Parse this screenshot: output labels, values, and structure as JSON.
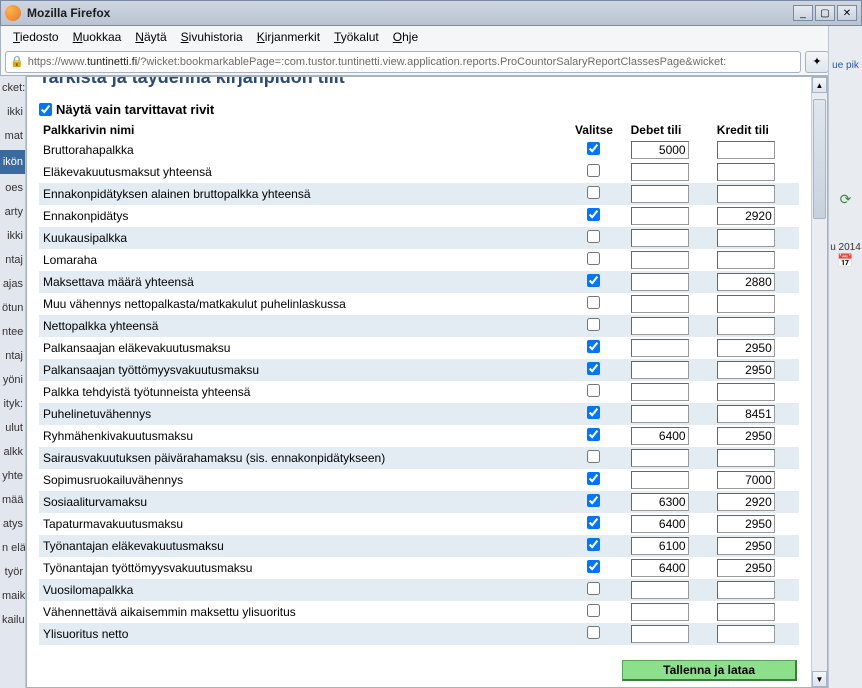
{
  "window": {
    "title": "Mozilla Firefox",
    "url_prefix": "https://www.",
    "url_domain": "tuntinetti.fi",
    "url_rest": "/?wicket:bookmarkablePage=:com.tustor.tuntinetti.view.application.reports.ProCountorSalaryReportClassesPage&wicket:"
  },
  "menubar": {
    "items": [
      "Tiedosto",
      "Muokkaa",
      "Näytä",
      "Sivuhistoria",
      "Kirjanmerkit",
      "Työkalut",
      "Ohje"
    ]
  },
  "right_strip": {
    "link_fragment": "ue pik",
    "date_fragment": "u 2014"
  },
  "left_strip": {
    "frags": [
      "cket:",
      "ikki",
      "mat",
      "ikön",
      "oes",
      "arty",
      "ikki",
      "ntaj",
      "ajas",
      "ötun",
      "ntee",
      "ntaj",
      "yöni",
      "ityk:",
      "ulut",
      "alkk",
      "yhte",
      "mää",
      "atys",
      "n elä",
      "työr",
      "maik",
      "kailu"
    ]
  },
  "page": {
    "cut_title": "Tarkista ja täydennä kirjanpidon tilit",
    "filter_checkbox_label": "Näytä vain tarvittavat rivit",
    "filter_checked": true,
    "headers": {
      "name": "Palkkarivin nimi",
      "select": "Valitse",
      "debit": "Debet tili",
      "credit": "Kredit tili"
    },
    "save_button": "Tallenna ja lataa",
    "rows": [
      {
        "name": "Bruttorahapalkka",
        "checked": true,
        "debit": "5000",
        "credit": "",
        "zebra": false
      },
      {
        "name": "Eläkevakuutusmaksut yhteensä",
        "checked": false,
        "debit": "",
        "credit": "",
        "zebra": false
      },
      {
        "name": "Ennakonpidätyksen alainen bruttopalkka yhteensä",
        "checked": false,
        "debit": "",
        "credit": "",
        "zebra": true
      },
      {
        "name": "Ennakonpidätys",
        "checked": true,
        "debit": "",
        "credit": "2920",
        "zebra": false
      },
      {
        "name": "Kuukausipalkka",
        "checked": false,
        "debit": "",
        "credit": "",
        "zebra": true
      },
      {
        "name": "Lomaraha",
        "checked": false,
        "debit": "",
        "credit": "",
        "zebra": false
      },
      {
        "name": "Maksettava määrä yhteensä",
        "checked": true,
        "debit": "",
        "credit": "2880",
        "zebra": true
      },
      {
        "name": "Muu vähennys nettopalkasta/matkakulut puhelinlaskussa",
        "checked": false,
        "debit": "",
        "credit": "",
        "zebra": false
      },
      {
        "name": "Nettopalkka yhteensä",
        "checked": false,
        "debit": "",
        "credit": "",
        "zebra": true
      },
      {
        "name": "Palkansaajan eläkevakuutusmaksu",
        "checked": true,
        "debit": "",
        "credit": "2950",
        "zebra": false
      },
      {
        "name": "Palkansaajan työttömyysvakuutusmaksu",
        "checked": true,
        "debit": "",
        "credit": "2950",
        "zebra": true
      },
      {
        "name": "Palkka tehdyistä työtunneista yhteensä",
        "checked": false,
        "debit": "",
        "credit": "",
        "zebra": false
      },
      {
        "name": "Puhelinetuvähennys",
        "checked": true,
        "debit": "",
        "credit": "8451",
        "zebra": true
      },
      {
        "name": "Ryhmähenkivakuutusmaksu",
        "checked": true,
        "debit": "6400",
        "credit": "2950",
        "zebra": false
      },
      {
        "name": "Sairausvakuutuksen päivärahamaksu (sis. ennakonpidätykseen)",
        "checked": false,
        "debit": "",
        "credit": "",
        "zebra": true
      },
      {
        "name": "Sopimusruokailuvähennys",
        "checked": true,
        "debit": "",
        "credit": "7000",
        "zebra": false
      },
      {
        "name": "Sosiaaliturvamaksu",
        "checked": true,
        "debit": "6300",
        "credit": "2920",
        "zebra": true
      },
      {
        "name": "Tapaturmavakuutusmaksu",
        "checked": true,
        "debit": "6400",
        "credit": "2950",
        "zebra": false
      },
      {
        "name": "Työnantajan eläkevakuutusmaksu",
        "checked": true,
        "debit": "6100",
        "credit": "2950",
        "zebra": true
      },
      {
        "name": "Työnantajan työttömyysvakuutusmaksu",
        "checked": true,
        "debit": "6400",
        "credit": "2950",
        "zebra": false
      },
      {
        "name": "Vuosilomapalkka",
        "checked": false,
        "debit": "",
        "credit": "",
        "zebra": true
      },
      {
        "name": "Vähennettävä aikaisemmin maksettu ylisuoritus",
        "checked": false,
        "debit": "",
        "credit": "",
        "zebra": false
      },
      {
        "name": "Ylisuoritus netto",
        "checked": false,
        "debit": "",
        "credit": "",
        "zebra": true
      }
    ]
  }
}
